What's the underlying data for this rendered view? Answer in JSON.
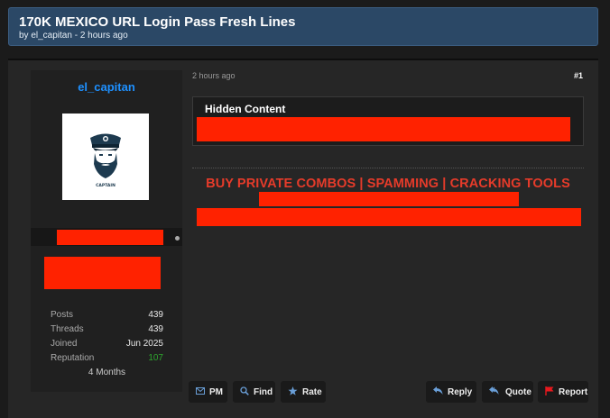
{
  "thread": {
    "title": "170K MEXICO URL Login Pass Fresh Lines",
    "meta": "by el_capitan - 2 hours ago"
  },
  "user": {
    "name": "el_capitan",
    "avatar_text": "CAPTAIN",
    "stats": [
      {
        "label": "Posts",
        "value": "439"
      },
      {
        "label": "Threads",
        "value": "439"
      },
      {
        "label": "Joined",
        "value": "Jun 2025"
      },
      {
        "label": "Reputation",
        "value": "107"
      }
    ],
    "membership": "4 Months"
  },
  "post": {
    "date": "2 hours ago",
    "number": "#1",
    "hidden_title": "Hidden Content",
    "promo": "BUY PRIVATE COMBOS | SPAMMING | CRACKING TOOLS"
  },
  "actions": {
    "pm": "PM",
    "find": "Find",
    "rate": "Rate",
    "reply": "Reply",
    "quote": "Quote",
    "report": "Report"
  },
  "icons": [
    "envelope-icon",
    "search-icon",
    "star-icon",
    "reply-icon",
    "quote-icon",
    "flag-icon",
    "online-status-icon"
  ],
  "colors": {
    "header_bg": "#2b4866",
    "username": "#1e90ff",
    "redaction": "#ff2200",
    "promo": "#e63b2a",
    "reputation": "#2ea52e",
    "report_flag": "#e8191e"
  }
}
